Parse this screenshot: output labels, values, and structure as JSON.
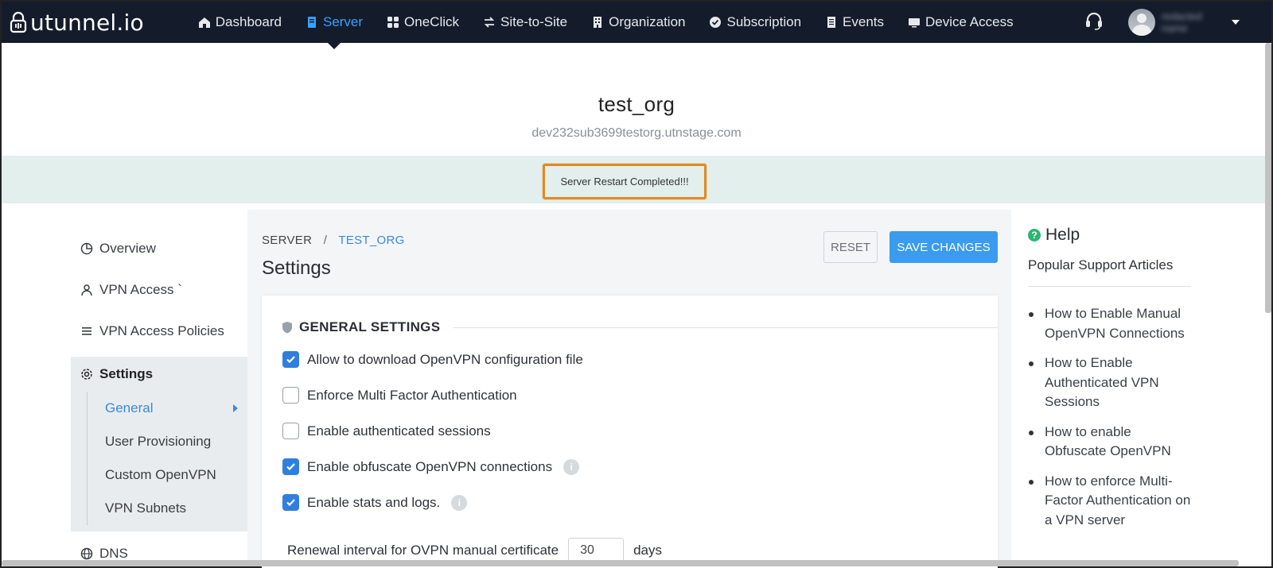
{
  "brand": {
    "name": "utunnel.io"
  },
  "nav": {
    "items": [
      {
        "label": "Dashboard",
        "icon": "home-icon"
      },
      {
        "label": "Server",
        "icon": "server-icon",
        "active": true
      },
      {
        "label": "OneClick",
        "icon": "grid-icon"
      },
      {
        "label": "Site-to-Site",
        "icon": "arrows-icon"
      },
      {
        "label": "Organization",
        "icon": "building-icon"
      },
      {
        "label": "Subscription",
        "icon": "check-circle-icon"
      },
      {
        "label": "Events",
        "icon": "list-icon"
      },
      {
        "label": "Device Access",
        "icon": "monitor-icon"
      }
    ],
    "user_name": "redacted name"
  },
  "org": {
    "title": "test_org",
    "domain": "dev232sub3699testorg.utnstage.com"
  },
  "banner": {
    "message": "Server Restart Completed!!!"
  },
  "sidebar": {
    "items": [
      {
        "label": "Overview",
        "icon": "pie-chart-icon"
      },
      {
        "label": "VPN Access `",
        "icon": "user-icon"
      },
      {
        "label": "VPN Access Policies",
        "icon": "list-icon"
      }
    ],
    "settings": {
      "label": "Settings",
      "icon": "gear-icon",
      "subitems": [
        {
          "label": "General",
          "active": true
        },
        {
          "label": "User Provisioning"
        },
        {
          "label": "Custom OpenVPN"
        },
        {
          "label": "VPN Subnets"
        }
      ]
    },
    "dns": {
      "label": "DNS",
      "icon": "globe-icon"
    }
  },
  "main": {
    "breadcrumb": {
      "root": "SERVER",
      "separator": "/",
      "current": "TEST_ORG"
    },
    "title": "Settings",
    "reset_label": "RESET",
    "save_label": "SAVE CHANGES",
    "section_title": "GENERAL SETTINGS",
    "options": [
      {
        "label": "Allow to download OpenVPN configuration file",
        "checked": true,
        "info": false
      },
      {
        "label": "Enforce Multi Factor Authentication",
        "checked": false,
        "info": false
      },
      {
        "label": "Enable authenticated sessions",
        "checked": false,
        "info": false
      },
      {
        "label": "Enable obfuscate OpenVPN connections",
        "checked": true,
        "info": true
      },
      {
        "label": "Enable stats and logs.",
        "checked": true,
        "info": true
      }
    ],
    "renewal": {
      "label": "Renewal interval for OVPN manual certificate",
      "value": "30",
      "unit": "days"
    }
  },
  "help": {
    "title": "Help",
    "subtitle": "Popular Support Articles",
    "articles": [
      "How to Enable Manual OpenVPN Connections",
      "How to Enable Authenticated VPN Sessions",
      "How to enable Obfuscate OpenVPN",
      "How to enforce Multi-Factor Authentication on a VPN server"
    ]
  },
  "colors": {
    "nav_bg": "#141c2b",
    "accent": "#3a9bef",
    "banner_bg": "#e2efec",
    "highlight": "#e08a25",
    "help_icon": "#2bb673"
  }
}
